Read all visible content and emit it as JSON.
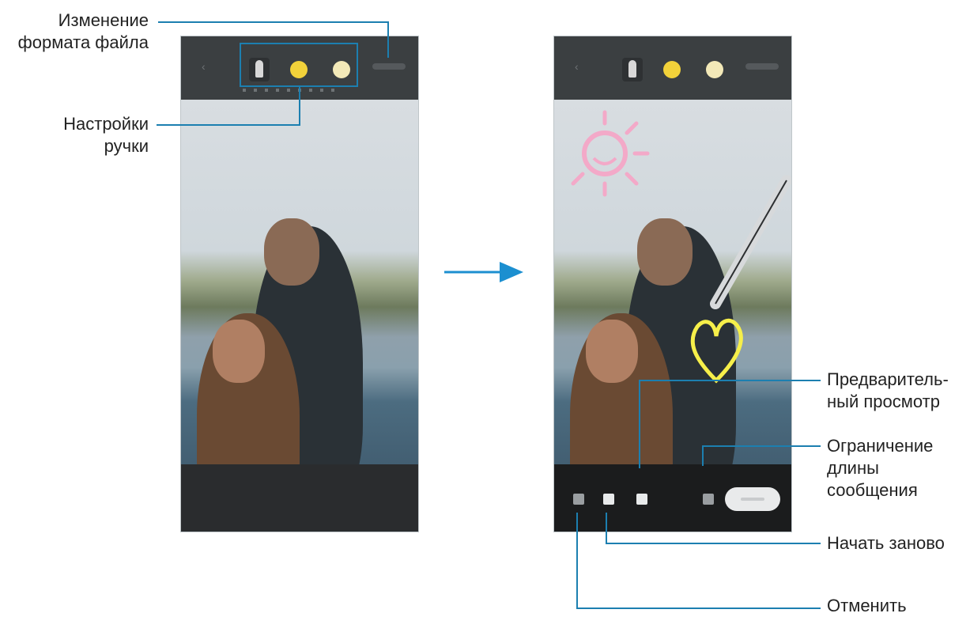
{
  "callouts": {
    "file_format": [
      "Изменение",
      "формата файла"
    ],
    "pen_settings": [
      "Настройки",
      "ручки"
    ],
    "preview": [
      "Предваритель-",
      "ный просмотр"
    ],
    "message_limit": [
      "Ограничение",
      "длины",
      "сообщения"
    ],
    "start_over": "Начать заново",
    "undo": "Отменить"
  },
  "colors": {
    "callout_line": "#1c7fb0",
    "arrow": "#1c8fd0",
    "pen_yellow": "#f2d23a",
    "pen_cream": "#f3e9b8"
  },
  "icons": {
    "pen_style": "pen-icon",
    "back": "back-icon",
    "undo": "undo-icon",
    "erase": "eraser-icon",
    "preview": "play-icon",
    "limit": "timer-icon",
    "send": "send-button"
  }
}
